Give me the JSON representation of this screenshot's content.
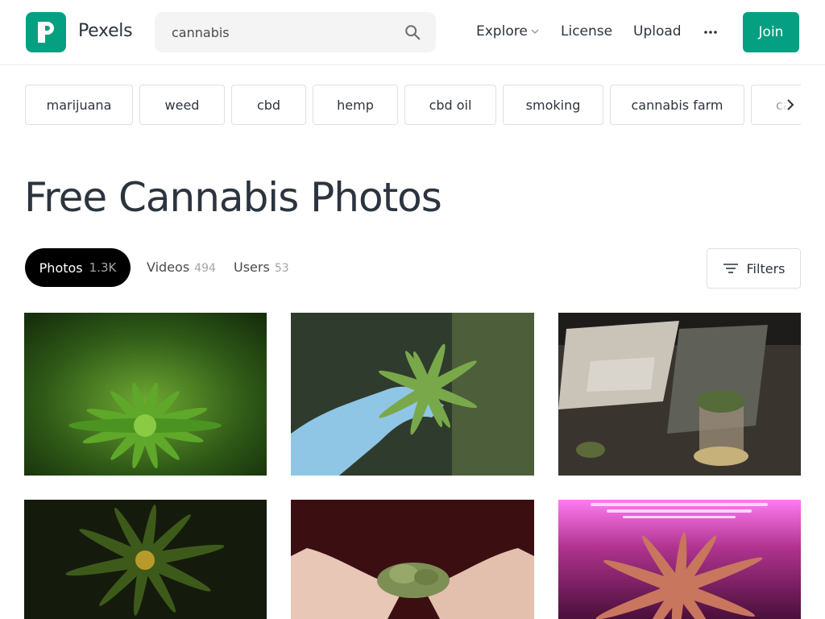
{
  "header": {
    "brand": "Pexels",
    "search_value": "cannabis",
    "nav": {
      "explore": "Explore",
      "license": "License",
      "upload": "Upload"
    },
    "join_label": "Join",
    "brand_color": "#05a081"
  },
  "tags": [
    "marijuana",
    "weed",
    "cbd",
    "hemp",
    "cbd oil",
    "smoking",
    "cannabis farm",
    "cannabis"
  ],
  "page_title": "Free Cannabis Photos",
  "tabs": {
    "photos": {
      "label": "Photos",
      "count": "1.3K"
    },
    "videos": {
      "label": "Videos",
      "count": "494"
    },
    "users": {
      "label": "Users",
      "count": "53"
    }
  },
  "filters_label": "Filters",
  "icons": [
    "pexels-logo-icon",
    "search-icon",
    "chevron-down-icon",
    "more-icon",
    "chevron-right-icon",
    "filter-icon"
  ]
}
